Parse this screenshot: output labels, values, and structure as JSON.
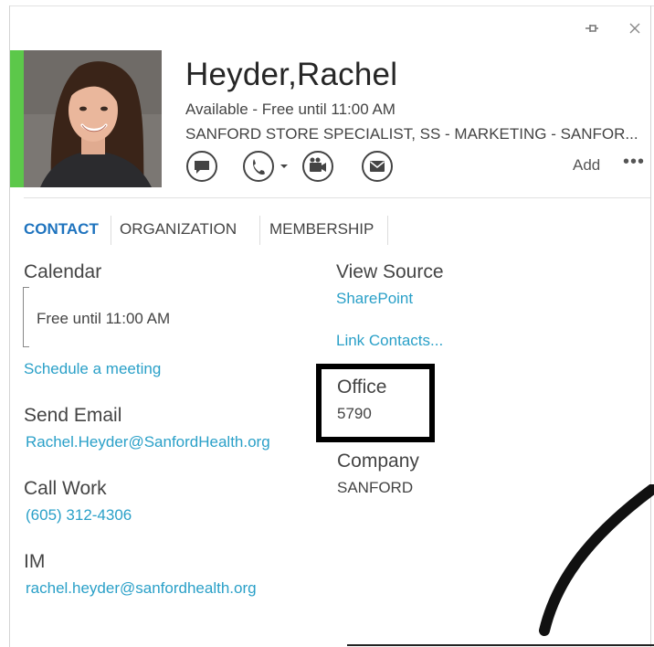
{
  "window": {
    "pin_icon": "pin-icon",
    "close_icon": "close-icon"
  },
  "contact": {
    "name": "Heyder,Rachel",
    "status": "Available - Free until 11:00 AM",
    "title": "SANFORD STORE SPECIALIST, SS - MARKETING - SANFOR...",
    "presence_color": "#5cc84a"
  },
  "actions": {
    "add_label": "Add",
    "more_label": "•••"
  },
  "tabs": [
    {
      "label": "CONTACT",
      "active": true
    },
    {
      "label": "ORGANIZATION",
      "active": false
    },
    {
      "label": "MEMBERSHIP",
      "active": false
    }
  ],
  "details": {
    "calendar": {
      "label": "Calendar",
      "value": "Free until 11:00 AM",
      "link": "Schedule a meeting"
    },
    "send_email": {
      "label": "Send Email",
      "value": "Rachel.Heyder@SanfordHealth.org"
    },
    "call_work": {
      "label": "Call Work",
      "value": "(605) 312-4306"
    },
    "im": {
      "label": "IM",
      "value": "rachel.heyder@sanfordhealth.org"
    },
    "view_source": {
      "label": "View Source",
      "value": "SharePoint"
    },
    "link_contacts": "Link Contacts...",
    "office": {
      "label": "Office",
      "value": "5790"
    },
    "company": {
      "label": "Company",
      "value": "SANFORD"
    }
  },
  "colors": {
    "accent": "#1e73be",
    "link": "#2aa0c8",
    "available": "#5cc84a"
  }
}
